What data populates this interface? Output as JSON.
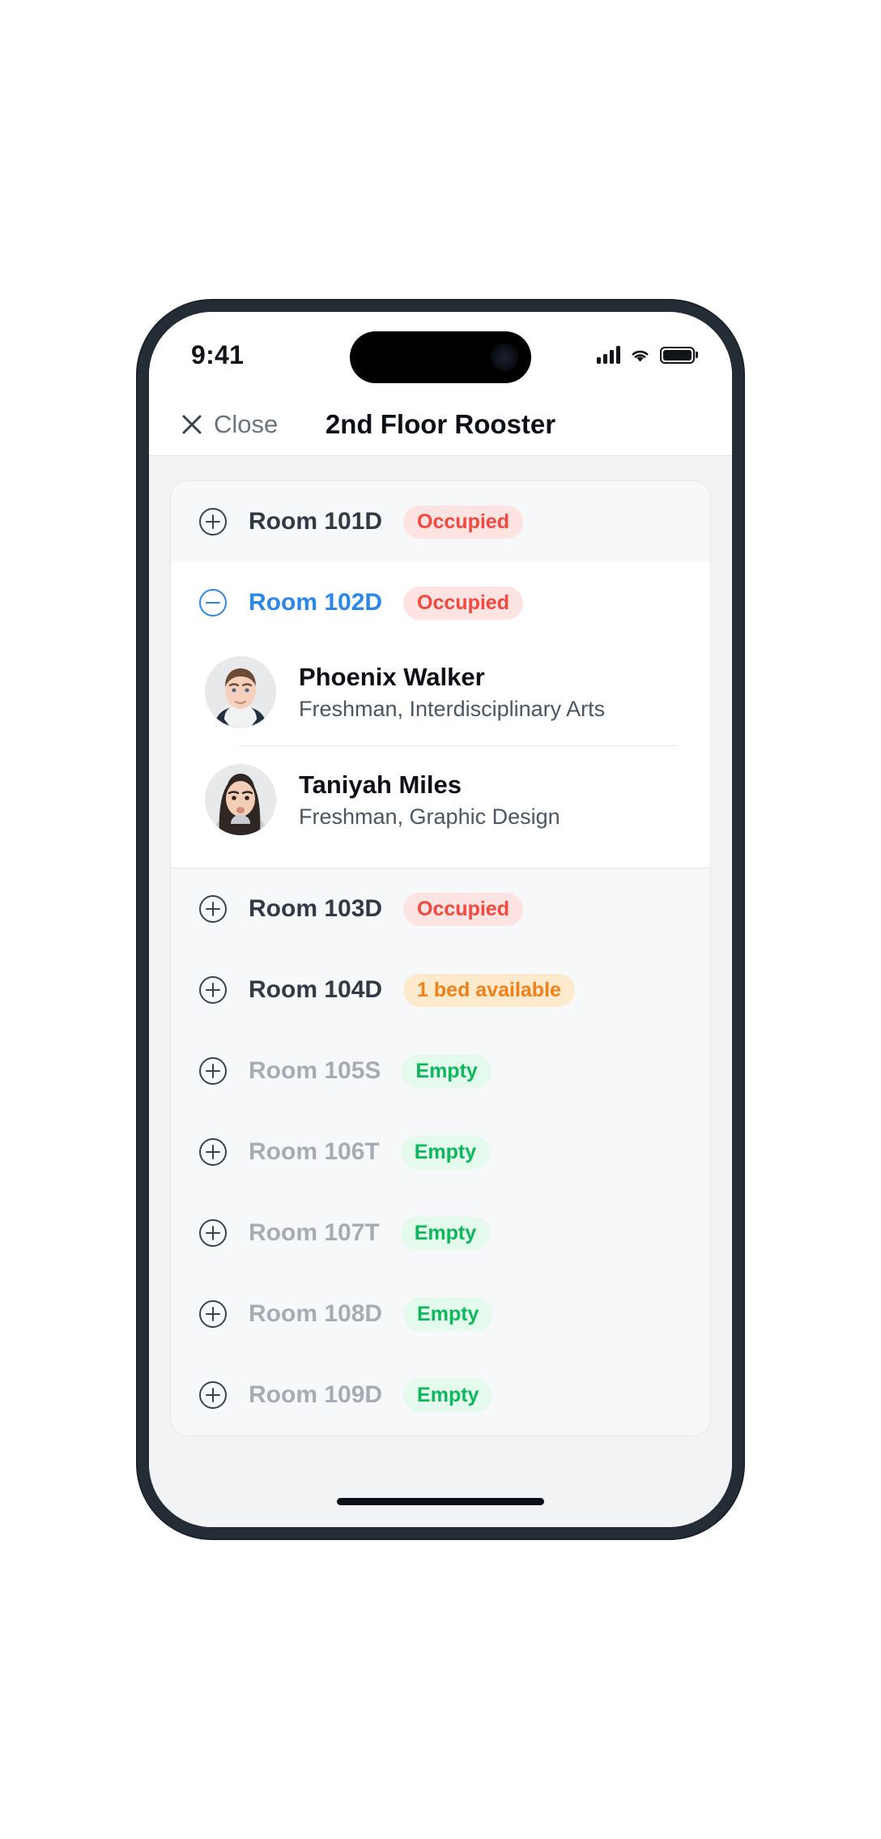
{
  "status_bar": {
    "time": "9:41",
    "signal_icon": "cellular-signal-icon",
    "wifi_icon": "wifi-icon",
    "battery_icon": "battery-icon"
  },
  "nav": {
    "close_label": "Close",
    "close_icon": "close-x-icon",
    "title": "2nd Floor Rooster"
  },
  "colors": {
    "accent_blue": "#2b87e8",
    "occupied_text": "#f4483e",
    "occupied_bg": "#fde3e1",
    "partial_text": "#f0811a",
    "partial_bg": "#fdeacd",
    "empty_text": "#0cb85c",
    "empty_bg": "#e3faec",
    "row_bg": "#f7f8fa",
    "page_bg": "#f2f3f5"
  },
  "rooms": [
    {
      "name": "Room 101D",
      "status": "Occupied",
      "status_type": "occupied",
      "expanded": false,
      "toggle_icon": "plus-circle-icon",
      "occupants": []
    },
    {
      "name": "Room 102D",
      "status": "Occupied",
      "status_type": "occupied",
      "expanded": true,
      "toggle_icon": "minus-circle-icon",
      "occupants": [
        {
          "name": "Phoenix Walker",
          "detail": "Freshman, Interdisciplinary Arts",
          "avatar": "male-student-photo"
        },
        {
          "name": "Taniyah Miles",
          "detail": "Freshman, Graphic Design",
          "avatar": "female-student-photo"
        }
      ]
    },
    {
      "name": "Room 103D",
      "status": "Occupied",
      "status_type": "occupied",
      "expanded": false,
      "toggle_icon": "plus-circle-icon",
      "occupants": []
    },
    {
      "name": "Room 104D",
      "status": "1 bed available",
      "status_type": "partial",
      "expanded": false,
      "toggle_icon": "plus-circle-icon",
      "occupants": []
    },
    {
      "name": "Room 105S",
      "status": "Empty",
      "status_type": "empty",
      "expanded": false,
      "toggle_icon": "plus-circle-icon",
      "occupants": []
    },
    {
      "name": "Room 106T",
      "status": "Empty",
      "status_type": "empty",
      "expanded": false,
      "toggle_icon": "plus-circle-icon",
      "occupants": []
    },
    {
      "name": "Room 107T",
      "status": "Empty",
      "status_type": "empty",
      "expanded": false,
      "toggle_icon": "plus-circle-icon",
      "occupants": []
    },
    {
      "name": "Room 108D",
      "status": "Empty",
      "status_type": "empty",
      "expanded": false,
      "toggle_icon": "plus-circle-icon",
      "occupants": []
    },
    {
      "name": "Room 109D",
      "status": "Empty",
      "status_type": "empty",
      "expanded": false,
      "toggle_icon": "plus-circle-icon",
      "occupants": []
    }
  ]
}
